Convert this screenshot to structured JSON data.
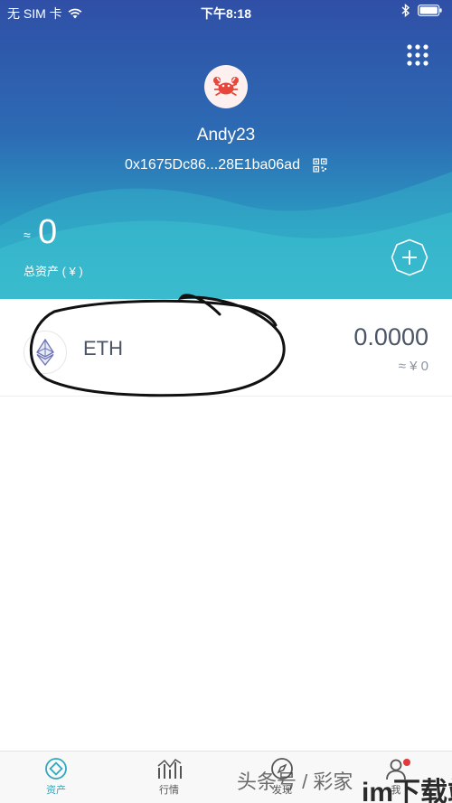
{
  "status_bar": {
    "carrier": "无 SIM 卡",
    "time": "下午8:18"
  },
  "profile": {
    "username": "Andy23",
    "address": "0x1675Dc86...28E1ba06ad"
  },
  "balance": {
    "approx_symbol": "≈",
    "total": "0",
    "total_label": "总资产 ( ¥ )"
  },
  "assets": [
    {
      "symbol": "ETH",
      "amount": "0.0000",
      "fiat": "≈ ¥ 0",
      "icon": "ethereum-icon"
    }
  ],
  "tabs": [
    {
      "label": "资产",
      "icon": "assets-icon",
      "active": true
    },
    {
      "label": "行情",
      "icon": "market-chart-icon",
      "active": false
    },
    {
      "label": "发现",
      "icon": "discover-icon",
      "active": false
    },
    {
      "label": "我",
      "icon": "profile-icon",
      "active": false
    }
  ],
  "watermark": {
    "text": "头条号 / 彩家",
    "logo": "im下载站"
  },
  "colors": {
    "gradient_top": "#2f4fa6",
    "gradient_bottom": "#36bccb",
    "accent": "#2fa8bd",
    "badge": "#e23a3a"
  }
}
